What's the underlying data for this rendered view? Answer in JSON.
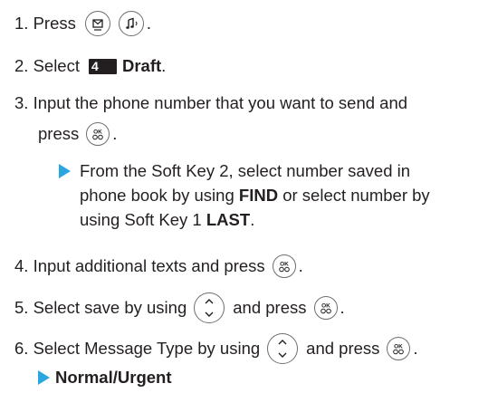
{
  "steps": {
    "s1": {
      "text": "1. Press",
      "end": "."
    },
    "s2": {
      "pre": "2. Select",
      "badge": "4",
      "bold": "Draft",
      "end": "."
    },
    "s3": {
      "line1": "3. Input the phone number that you want to send and",
      "line2": "press",
      "end": "."
    },
    "sub3": {
      "line1": "From the Soft Key 2, select number saved in",
      "line2_pre": "phone book by using",
      "line2_bold": "FIND",
      "line2_post": "or select number by",
      "line3_pre": "using Soft Key 1",
      "line3_bold": "LAST",
      "line3_end": "."
    },
    "s4": {
      "text": "4. Input additional texts and press",
      "end": "."
    },
    "s5": {
      "pre": "5. Select save by using",
      "mid": "and press",
      "end": "."
    },
    "s6": {
      "pre": "6. Select Message Type by using",
      "mid": "and press",
      "end": "."
    },
    "sub6": {
      "bold": "Normal/Urgent"
    }
  },
  "icons": {
    "message_key": "envelope-key-icon",
    "music_key": "music-note-key-icon",
    "ok_key": "ok-key-icon",
    "nav_key": "up-down-navigation-key-icon"
  },
  "colors": {
    "arrow": "#2aa7e0",
    "text": "#231f20",
    "badge_bg": "#231f20",
    "key_outline": "#6d6e71"
  }
}
